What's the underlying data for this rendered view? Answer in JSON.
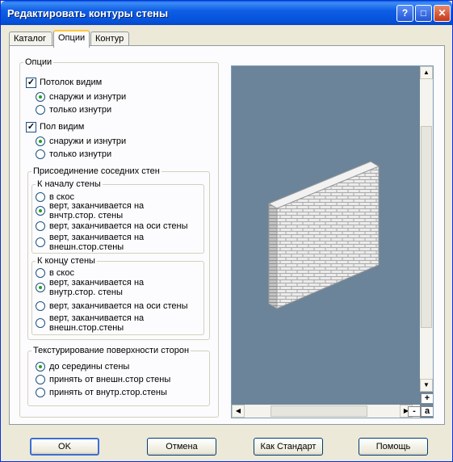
{
  "window": {
    "title": "Редактировать контуры стены"
  },
  "tabs": [
    "Каталог",
    "Опции",
    "Контур"
  ],
  "options_group": {
    "legend": "Опции",
    "ceiling": {
      "label": "Потолок видим",
      "checked": true,
      "radios": [
        {
          "label": "снаружи и изнутри",
          "selected": true
        },
        {
          "label": "только изнутри",
          "selected": false
        }
      ]
    },
    "floor": {
      "label": "Пол видим",
      "checked": true,
      "radios": [
        {
          "label": "снаружи и изнутри",
          "selected": true
        },
        {
          "label": "только изнутри",
          "selected": false
        }
      ]
    }
  },
  "joining": {
    "legend": "Присоединение соседних стен",
    "start": {
      "legend": "К началу стены",
      "radios": [
        {
          "label": "в скос",
          "selected": false
        },
        {
          "label": "верт, заканчивается на внчтр.стор. стены",
          "line1": "верт, заканчивается на",
          "line2": "внчтр.стор. стены",
          "selected": true
        },
        {
          "label": "верт, заканчивается на оси стены",
          "selected": false
        },
        {
          "label": "верт, заканчивается на внешн.стор.стены",
          "line1": "верт, заканчивается на",
          "line2": "внешн.стор.стены",
          "selected": false
        }
      ]
    },
    "end": {
      "legend": "К концу стены",
      "radios": [
        {
          "label": "в скос",
          "selected": false
        },
        {
          "label": "верт, заканчивается на внутр.стор. стены",
          "line1": "верт, заканчивается на",
          "line2": "внутр.стор. стены",
          "selected": true
        },
        {
          "label": "верт, заканчивается на оси стены",
          "selected": false
        },
        {
          "label": "верт, заканчивается на внешн.стор.стены",
          "line1": "верт, заканчивается на",
          "line2": "внешн.стор.стены",
          "selected": false
        }
      ]
    }
  },
  "texturing": {
    "legend": "Текстурирование поверхности сторон",
    "radios": [
      {
        "label": "до середины стены",
        "selected": true
      },
      {
        "label": "принять от внешн.стор стены",
        "selected": false
      },
      {
        "label": "принять от внутр.стор.стены",
        "selected": false
      }
    ]
  },
  "preview": {
    "zoom_in": "+",
    "zoom_out": "-",
    "zoom_auto": "a",
    "background_color": "#6b8499"
  },
  "buttons": {
    "ok": "OK",
    "cancel": "Отмена",
    "default": "Как Стандарт",
    "help": "Помощь"
  }
}
